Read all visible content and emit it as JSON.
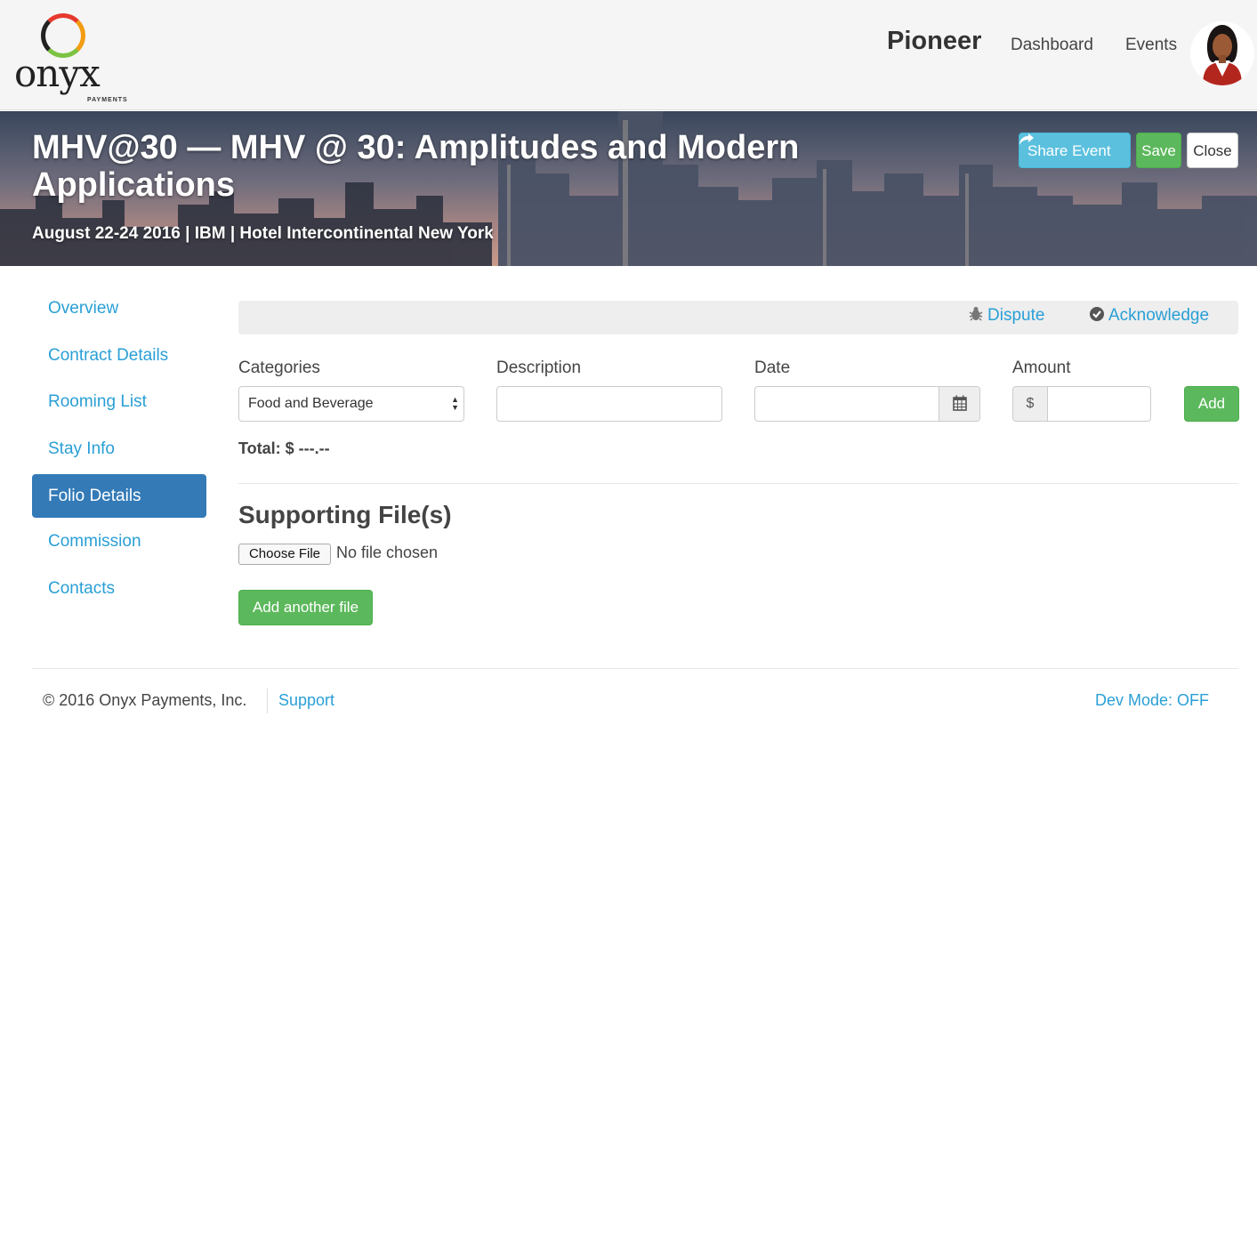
{
  "header": {
    "logo_text": "onyx",
    "logo_subtext": "PAYMENTS",
    "brand": "Pioneer",
    "nav": [
      {
        "label": "Dashboard"
      },
      {
        "label": "Events"
      }
    ]
  },
  "event": {
    "title": "MHV@30 — MHV @ 30: Amplitudes and Modern Applications",
    "subtitle": "August 22-24 2016 | IBM | Hotel Intercontinental New York",
    "actions": {
      "share_label": "Share Event",
      "save_label": "Save",
      "close_label": "Close"
    }
  },
  "sidebar": {
    "items": [
      {
        "label": "Overview",
        "active": false
      },
      {
        "label": "Contract Details",
        "active": false
      },
      {
        "label": "Rooming List",
        "active": false
      },
      {
        "label": "Stay Info",
        "active": false
      },
      {
        "label": "Folio Details",
        "active": true
      },
      {
        "label": "Commission",
        "active": false
      },
      {
        "label": "Contacts",
        "active": false
      }
    ]
  },
  "folio": {
    "dispute_label": "Dispute",
    "acknowledge_label": "Acknowledge",
    "categories_label": "Categories",
    "category_selected": "Food and Beverage",
    "description_label": "Description",
    "description_value": "",
    "date_label": "Date",
    "date_value": "",
    "amount_label": "Amount",
    "currency_symbol": "$",
    "amount_value": "",
    "add_label": "Add",
    "total_text": "Total: $ ---.--"
  },
  "files": {
    "title": "Supporting File(s)",
    "choose_label": "Choose File",
    "no_file_text": "No file chosen",
    "add_another_label": "Add another file"
  },
  "footer": {
    "copyright": "© 2016 Onyx Payments, Inc.",
    "support_label": "Support",
    "dev_mode": "Dev Mode: OFF"
  },
  "colors": {
    "link": "#2a9fd6",
    "primary": "#337ab7",
    "success": "#5cb85c",
    "info": "#5bc0de"
  }
}
